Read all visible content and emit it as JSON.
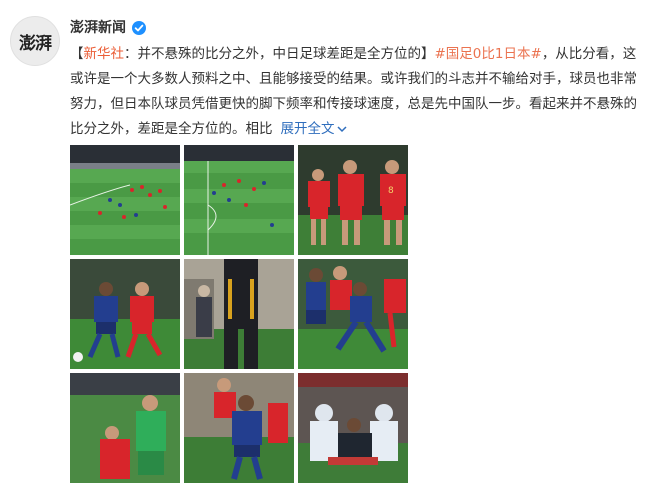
{
  "author": {
    "avatar_text": "澎湃",
    "name": "澎湃新闻"
  },
  "post": {
    "bracket_open": "【",
    "source": "新华社",
    "headline_rest": "：并不悬殊的比分之外，中日足球差距是全方位的】",
    "hashtag": "#国足0比1日本#",
    "line1_tail": "，从比分看，这",
    "line2": "或许是一个大多数人预料之中、且能够接受的结果。或许我们的斗志并不输给对手，球员也非常",
    "line3": "努力，但日本队球员凭借更快的脚下频率和传接球速度，总是先中国队一步。看起来并不悬殊的",
    "line4": "比分之外，差距是全方位的。相比",
    "expand_label": "展开全文"
  },
  "colors": {
    "pitch_green": "#3f8f3a",
    "china_red": "#d8252b",
    "japan_blue": "#233e8f",
    "link_orange": "#eb7350",
    "expand_blue": "#2f6ebd"
  }
}
